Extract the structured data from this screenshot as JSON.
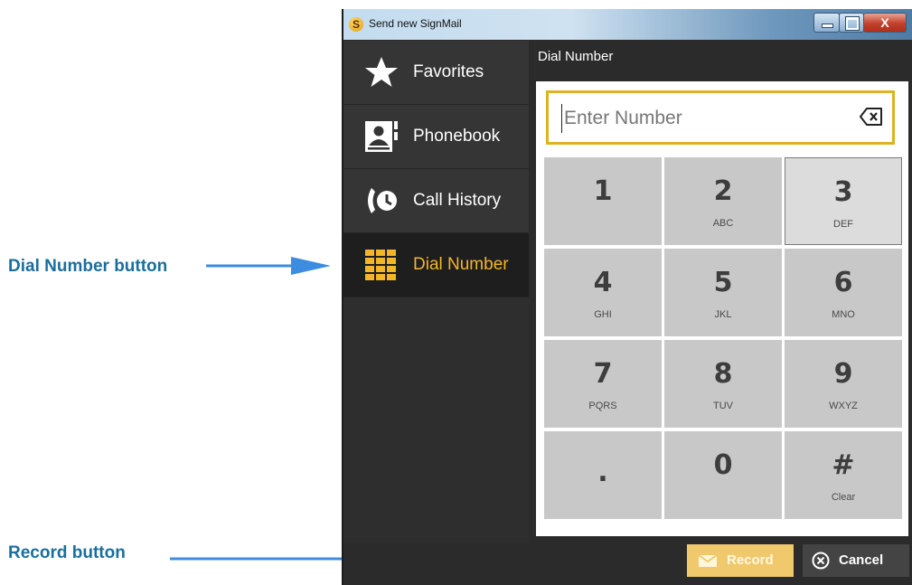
{
  "annotations": {
    "dial_number": "Dial Number button",
    "record": "Record button"
  },
  "window": {
    "title": "Send new SignMail",
    "app_icon_letter": "S",
    "close_glyph": "X"
  },
  "sidebar": {
    "items": [
      {
        "label": "Favorites",
        "icon": "star-icon"
      },
      {
        "label": "Phonebook",
        "icon": "phonebook-icon"
      },
      {
        "label": "Call History",
        "icon": "call-history-icon"
      },
      {
        "label": "Dial Number",
        "icon": "keypad-icon",
        "active": true
      }
    ]
  },
  "main": {
    "title": "Dial Number",
    "number_field": {
      "value": "",
      "placeholder": "Enter Number"
    },
    "keys": [
      {
        "digit": "1",
        "letters": ""
      },
      {
        "digit": "2",
        "letters": "ABC"
      },
      {
        "digit": "3",
        "letters": "DEF",
        "highlighted": true
      },
      {
        "digit": "4",
        "letters": "GHI"
      },
      {
        "digit": "5",
        "letters": "JKL"
      },
      {
        "digit": "6",
        "letters": "MNO"
      },
      {
        "digit": "7",
        "letters": "PQRS"
      },
      {
        "digit": "8",
        "letters": "TUV"
      },
      {
        "digit": "9",
        "letters": "WXYZ"
      },
      {
        "digit": ".",
        "letters": ""
      },
      {
        "digit": "0",
        "letters": ""
      },
      {
        "digit": "#",
        "letters": "Clear"
      }
    ]
  },
  "footer": {
    "record_label": "Record",
    "cancel_label": "Cancel"
  },
  "colors": {
    "accent": "#f3b628",
    "record_button": "#f0c96c",
    "annotation": "#1a6e9e",
    "arrow": "#3c8de0"
  }
}
